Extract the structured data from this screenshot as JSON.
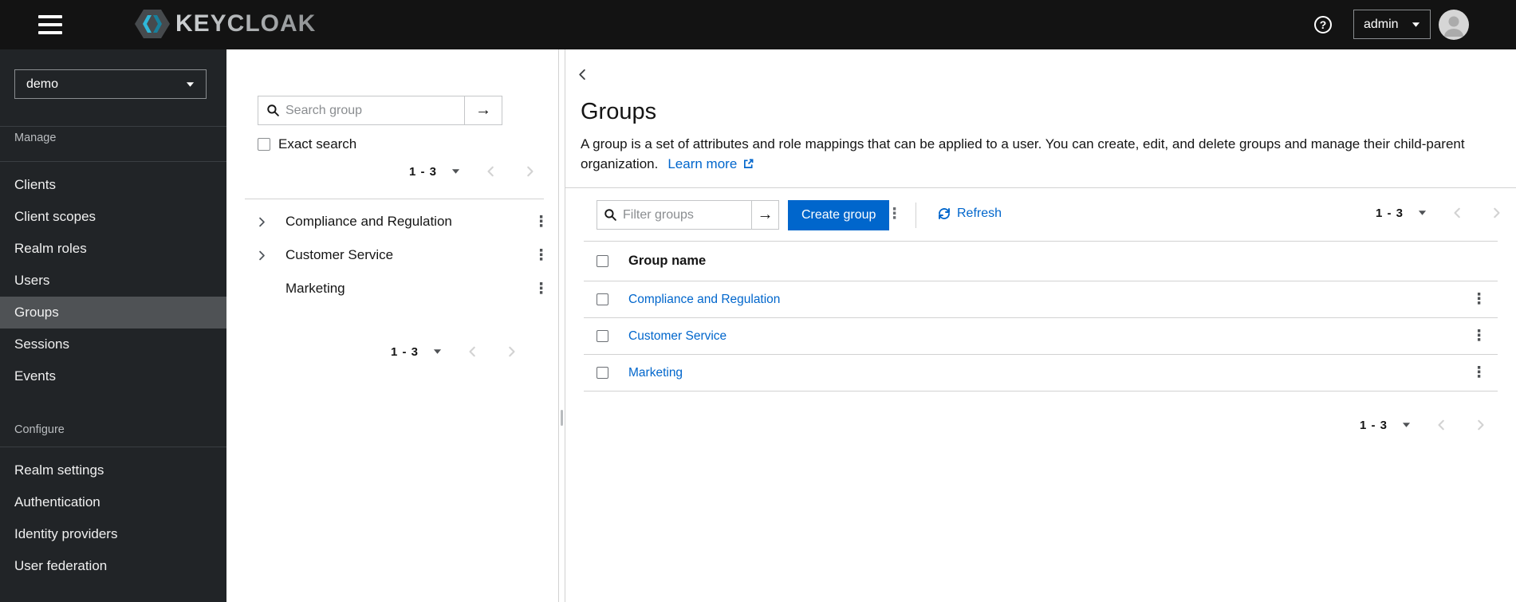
{
  "topbar": {
    "brand": "KEYCLOAK",
    "help_icon_glyph": "?",
    "username": "admin"
  },
  "sidebar": {
    "realm_selector": {
      "value": "demo"
    },
    "sections": [
      {
        "label": "Manage",
        "items": [
          "Clients",
          "Client scopes",
          "Realm roles",
          "Users",
          "Groups",
          "Sessions",
          "Events"
        ],
        "active_item": "Groups"
      },
      {
        "label": "Configure",
        "items": [
          "Realm settings",
          "Authentication",
          "Identity providers",
          "User federation"
        ]
      }
    ]
  },
  "tree_panel": {
    "search": {
      "placeholder": "Search group",
      "submit_glyph": "→"
    },
    "exact_search_label": "Exact search",
    "pagination_top": {
      "range": "1 - 3"
    },
    "pagination_bottom": {
      "range": "1 - 3"
    },
    "items": [
      {
        "name": "Compliance and Regulation",
        "expandable": true
      },
      {
        "name": "Customer Service",
        "expandable": true
      },
      {
        "name": "Marketing",
        "expandable": false
      }
    ],
    "kebab_glyph": "⋮"
  },
  "main": {
    "title": "Groups",
    "description": "A group is a set of attributes and role mappings that can be applied to a user. You can create, edit, and delete groups and manage their child-parent organization.",
    "learn_more_label": "Learn more",
    "toolbar": {
      "filter": {
        "placeholder": "Filter groups",
        "submit_glyph": "→"
      },
      "create_button": "Create group",
      "kebab_glyph": "⋮",
      "refresh_label": "Refresh",
      "pagination": {
        "range": "1 - 3"
      }
    },
    "table": {
      "columns": [
        "Group name"
      ],
      "rows": [
        {
          "name": "Compliance and Regulation"
        },
        {
          "name": "Customer Service"
        },
        {
          "name": "Marketing"
        }
      ]
    },
    "pagination_bottom": {
      "range": "1 - 3"
    }
  },
  "colors": {
    "accent": "#0066cc",
    "masthead_bg": "#131313",
    "sidebar_bg": "#212427",
    "sidebar_active_bg": "#4f5255",
    "border": "#d2d2d2",
    "link": "#0066cc"
  }
}
